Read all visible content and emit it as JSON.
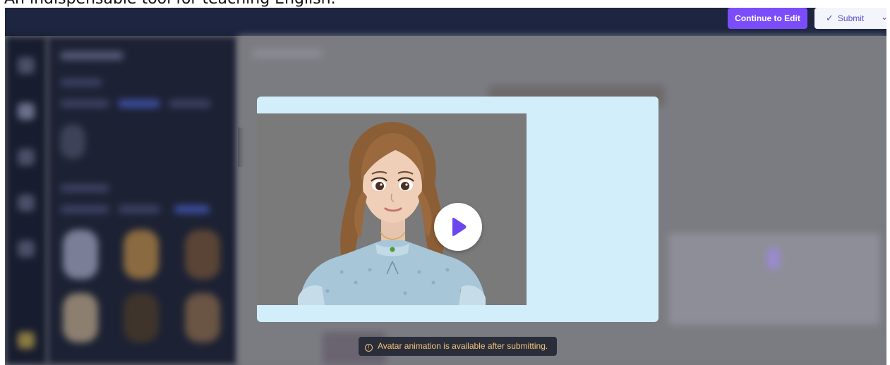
{
  "caption": "An indispensable tool for teaching English.",
  "topbar": {
    "continue_label": "Continue to Edit",
    "submit_label": "Submit",
    "submit_icon": "check-icon",
    "more_icon": "chevron-down-icon"
  },
  "modal": {
    "play_icon": "play-icon"
  },
  "toast": {
    "icon": "info-icon",
    "message": "Avatar animation is available after submitting."
  },
  "colors": {
    "accent": "#7b4dfa",
    "topbar": "#1d2540",
    "modal_bg": "#d2eefa",
    "toast_text": "#f2c47a"
  }
}
